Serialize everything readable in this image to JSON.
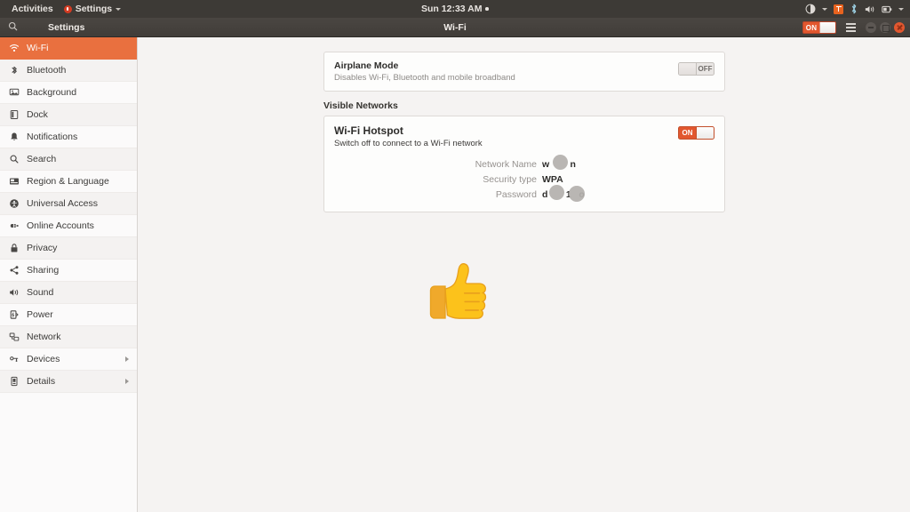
{
  "topbar": {
    "activities": "Activities",
    "app_menu": "Settings",
    "app_icon": "settings-app-icon",
    "clock": "Sun 12:33 AM",
    "clock_dot": "notification-dot",
    "tray": [
      {
        "name": "accessibility-icon"
      },
      {
        "name": "software-updater-icon"
      },
      {
        "name": "bluetooth-icon"
      },
      {
        "name": "volume-icon"
      },
      {
        "name": "battery-icon"
      }
    ]
  },
  "titlebar": {
    "search_icon": "search-icon",
    "sidebar_title": "Settings",
    "window_title": "Wi-Fi",
    "wifi_toggle_label": "ON",
    "menu_icon": "hamburger-menu-icon",
    "minimize": "minimize-button",
    "maximize": "maximize-button",
    "close": "close-button"
  },
  "sidebar": {
    "items": [
      {
        "label": "Wi-Fi",
        "icon": "wifi-icon",
        "active": true,
        "chevron": false
      },
      {
        "label": "Bluetooth",
        "icon": "bluetooth-icon",
        "active": false,
        "chevron": false
      },
      {
        "label": "Background",
        "icon": "background-icon",
        "active": false,
        "chevron": false
      },
      {
        "label": "Dock",
        "icon": "dock-icon",
        "active": false,
        "chevron": false
      },
      {
        "label": "Notifications",
        "icon": "notifications-icon",
        "active": false,
        "chevron": false
      },
      {
        "label": "Search",
        "icon": "search-icon",
        "active": false,
        "chevron": false
      },
      {
        "label": "Region & Language",
        "icon": "region-language-icon",
        "active": false,
        "chevron": false
      },
      {
        "label": "Universal Access",
        "icon": "universal-access-icon",
        "active": false,
        "chevron": false
      },
      {
        "label": "Online Accounts",
        "icon": "online-accounts-icon",
        "active": false,
        "chevron": false
      },
      {
        "label": "Privacy",
        "icon": "privacy-icon",
        "active": false,
        "chevron": false
      },
      {
        "label": "Sharing",
        "icon": "sharing-icon",
        "active": false,
        "chevron": false
      },
      {
        "label": "Sound",
        "icon": "sound-icon",
        "active": false,
        "chevron": false
      },
      {
        "label": "Power",
        "icon": "power-icon",
        "active": false,
        "chevron": false
      },
      {
        "label": "Network",
        "icon": "network-icon",
        "active": false,
        "chevron": false
      },
      {
        "label": "Devices",
        "icon": "devices-icon",
        "active": false,
        "chevron": true
      },
      {
        "label": "Details",
        "icon": "details-icon",
        "active": false,
        "chevron": true
      }
    ]
  },
  "main": {
    "airplane": {
      "title": "Airplane Mode",
      "subtitle": "Disables Wi-Fi, Bluetooth and mobile broadband",
      "toggle_label": "OFF",
      "toggle_state": "off"
    },
    "section_heading": "Visible Networks",
    "hotspot": {
      "title": "Wi-Fi Hotspot",
      "subtitle": "Switch off to connect to a Wi-Fi network",
      "toggle_label": "ON",
      "toggle_state": "on",
      "details": [
        {
          "label": "Network Name",
          "value": "w        n",
          "redacted": true
        },
        {
          "label": "Security type",
          "value": "WPA",
          "redacted": false
        },
        {
          "label": "Password",
          "value": "d       1   o",
          "redacted": true
        }
      ]
    },
    "overlay_emoji": "thumbs-up-emoji"
  },
  "colors": {
    "accent_orange": "#e9703f",
    "toggle_on": "#e2572f",
    "topbar_bg": "#3d3a36",
    "content_bg": "#f5f3f2",
    "sidebar_bg": "#fbfafa"
  }
}
